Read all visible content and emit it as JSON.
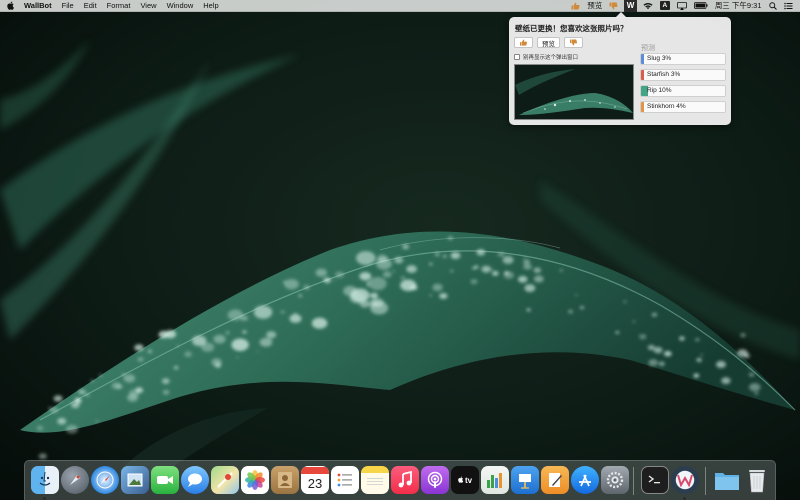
{
  "menubar": {
    "app_name": "WallBot",
    "menus": [
      "File",
      "Edit",
      "Format",
      "View",
      "Window",
      "Help"
    ],
    "preview_label": "预览",
    "ime_label": "A",
    "clock": "周三 下午9:31"
  },
  "popover": {
    "title": "壁纸已更换！您喜欢这张照片吗？",
    "preview_button": "预览",
    "dont_show_again": "别再显示这个弹出窗口",
    "predictions_title": "预测",
    "predictions": [
      {
        "label": "Slug 3%",
        "value": 0.03,
        "color": "#4a7fd6"
      },
      {
        "label": "Starfish 3%",
        "value": 0.03,
        "color": "#d64a3a"
      },
      {
        "label": "Rip 10%",
        "value": 0.1,
        "color": "#2f9a79"
      },
      {
        "label": "Stinkhorn 4%",
        "value": 0.04,
        "color": "#e0892c"
      }
    ]
  },
  "dock": {
    "calendar_day": "23",
    "tv_label": "tv"
  },
  "colors": {
    "menubar_bg": "#e8eae8",
    "popover_bg": "#eeeeee",
    "wallpaper_dark": "#0b1712",
    "leaf_green": "#2f6f5a"
  }
}
